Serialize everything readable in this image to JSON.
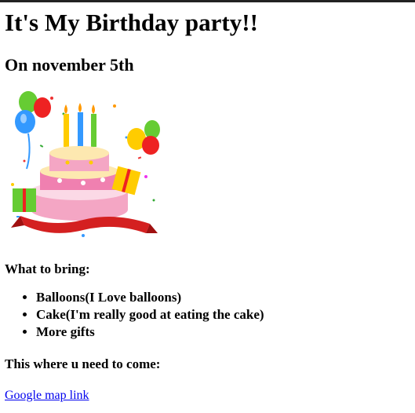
{
  "page": {
    "title": "It's My Birthday party!!",
    "date": "On november 5th",
    "image_icon": "birthday-cake-illustration",
    "bring_heading": "What to bring:",
    "bring_items": [
      "Balloons(I Love balloons)",
      "Cake(I'm really good at eating the cake)",
      "More gifts"
    ],
    "location_heading": "This where u need to come:",
    "map_link": "Google map link"
  },
  "colors": {
    "link": "#0000ee",
    "top_bar": "#222222"
  }
}
